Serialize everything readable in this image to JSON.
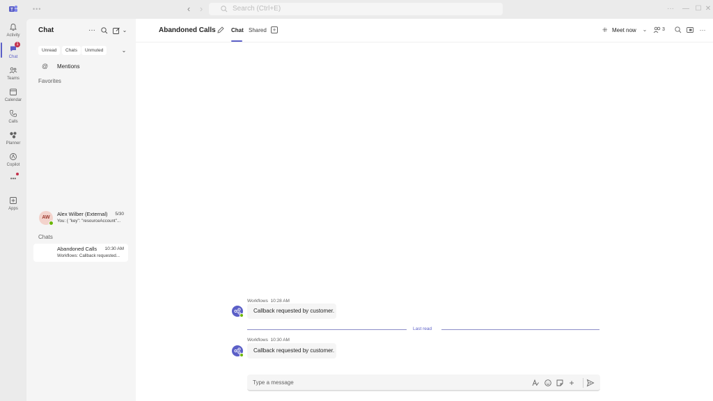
{
  "titlebar": {
    "search_placeholder": "Search (Ctrl+E)"
  },
  "rail": {
    "items": [
      {
        "label": "Activity"
      },
      {
        "label": "Chat",
        "badge": "1"
      },
      {
        "label": "Teams"
      },
      {
        "label": "Calendar"
      },
      {
        "label": "Calls"
      },
      {
        "label": "Planner"
      },
      {
        "label": "Copilot"
      },
      {
        "label": "Apps"
      }
    ],
    "more_label": "•••"
  },
  "chat_pane": {
    "title": "Chat",
    "filters": [
      "Unread",
      "Chats",
      "Unmuted"
    ],
    "mentions_label": "Mentions",
    "favorites_label": "Favorites",
    "chats_label": "Chats",
    "favorites": [
      {
        "initials": "AW",
        "name": "Alex Wilber (External)",
        "time": "5/30",
        "preview": "You: {    \"key\": \"resourceAccount\"..."
      }
    ],
    "chats": [
      {
        "name": "Abandoned Calls",
        "time": "10:30 AM",
        "preview": "Workflows: Callback requested..."
      }
    ]
  },
  "main": {
    "chat_title": "Abandoned Calls",
    "tabs": [
      "Chat",
      "Shared"
    ],
    "meet_now_label": "Meet now",
    "participants_count": "3",
    "messages": [
      {
        "sender": "Workflows",
        "time": "10:28 AM",
        "text": "Callback requested by customer."
      },
      {
        "sender": "Workflows",
        "time": "10:30 AM",
        "text": "Callback requested by customer."
      }
    ],
    "last_read_label": "Last read",
    "compose_placeholder": "Type a message"
  },
  "colors": {
    "accent": "#5b5fc7",
    "presence_available": "#6bb700",
    "badge": "#c4314b"
  }
}
